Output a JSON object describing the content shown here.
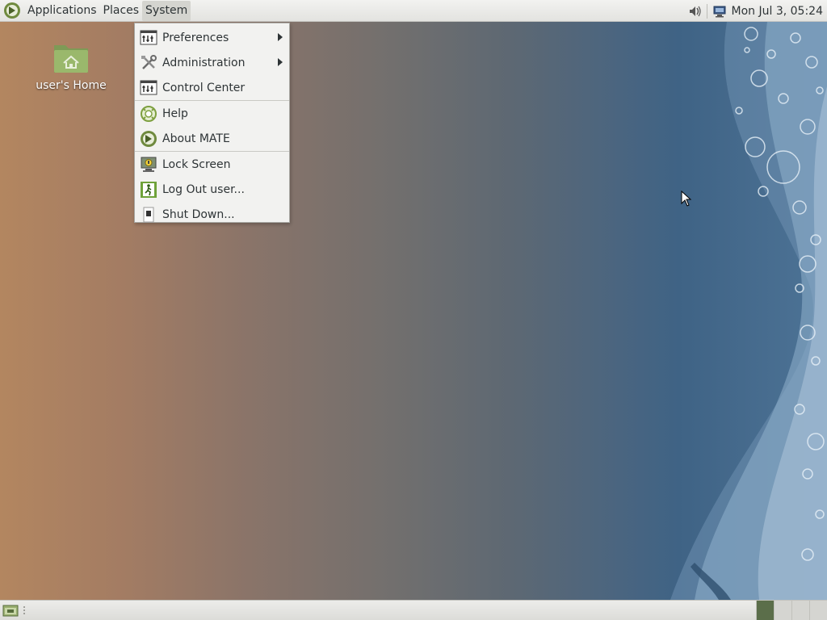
{
  "top_panel": {
    "menus": [
      {
        "label": "Applications"
      },
      {
        "label": "Places"
      },
      {
        "label": "System"
      }
    ],
    "clock": "Mon Jul  3, 05:24",
    "tray_icons": [
      "volume-icon",
      "network-icon"
    ]
  },
  "desktop": {
    "home_icon_label": "user's Home"
  },
  "system_menu": {
    "items": [
      {
        "label": "Preferences",
        "icon": "preferences-icon",
        "submenu": true
      },
      {
        "label": "Administration",
        "icon": "administration-icon",
        "submenu": true
      },
      {
        "label": "Control Center",
        "icon": "control-center-icon",
        "submenu": false
      },
      {
        "label": "Help",
        "icon": "help-icon",
        "submenu": false
      },
      {
        "label": "About MATE",
        "icon": "mate-logo-icon",
        "submenu": false
      },
      {
        "label": "Lock Screen",
        "icon": "lock-screen-icon",
        "submenu": false
      },
      {
        "label": "Log Out user...",
        "icon": "logout-icon",
        "submenu": false
      },
      {
        "label": "Shut Down...",
        "icon": "shutdown-icon",
        "submenu": false
      }
    ]
  },
  "bottom_panel": {
    "workspace_count": 4,
    "active_workspace": 1
  },
  "colors": {
    "panel_bg": "#ececea",
    "menu_bg": "#f2f2f0",
    "mate_green": "#87a556",
    "active_workspace": "#5b6e4a"
  }
}
